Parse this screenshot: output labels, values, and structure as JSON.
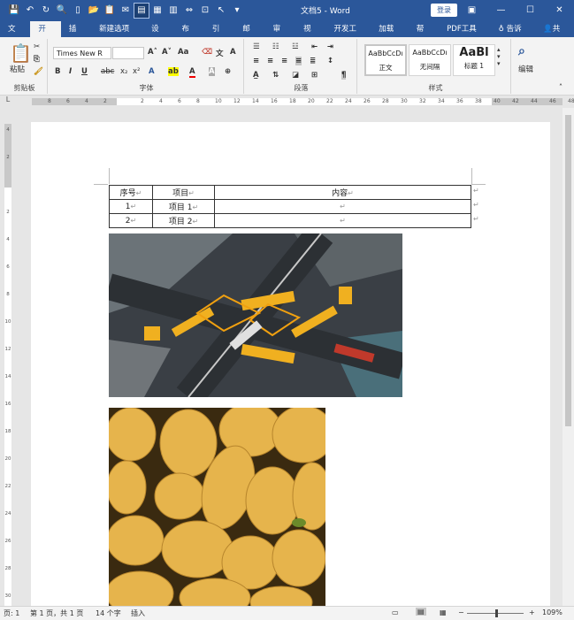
{
  "titlebar": {
    "doc_title": "文档5 - Word",
    "login_label": "登录"
  },
  "menu_tabs": [
    {
      "label": "文件"
    },
    {
      "label": "开始"
    },
    {
      "label": "插入"
    },
    {
      "label": "新建选项卡"
    },
    {
      "label": "设计"
    },
    {
      "label": "布局"
    },
    {
      "label": "引用"
    },
    {
      "label": "邮件"
    },
    {
      "label": "审阅"
    },
    {
      "label": "视图"
    },
    {
      "label": "开发工具"
    },
    {
      "label": "加载项"
    },
    {
      "label": "帮助"
    },
    {
      "label": "PDF工具集"
    }
  ],
  "tell_me": "告诉我",
  "share": "共享",
  "ribbon": {
    "clipboard": {
      "label": "剪贴板",
      "paste": "粘贴"
    },
    "font": {
      "label": "字体",
      "font_name": "Times New R",
      "font_size": ""
    },
    "paragraph": {
      "label": "段落"
    },
    "styles": {
      "label": "样式",
      "items": [
        {
          "preview": "AaBbCcDı",
          "name": "正文"
        },
        {
          "preview": "AaBbCcDı",
          "name": "无间隔"
        },
        {
          "preview": "AaBl",
          "name": "标题 1"
        }
      ]
    },
    "editing": {
      "label": "编辑"
    }
  },
  "ruler": {
    "ticks": [
      "8",
      "6",
      "4",
      "2",
      "",
      "2",
      "4",
      "6",
      "8",
      "10",
      "12",
      "14",
      "16",
      "18",
      "20",
      "22",
      "24",
      "26",
      "28",
      "30",
      "32",
      "34",
      "36",
      "38",
      "40",
      "42",
      "44",
      "46",
      "48"
    ]
  },
  "vruler": {
    "ticks": [
      "4",
      "2",
      "",
      "2",
      "4",
      "6",
      "8",
      "10",
      "12",
      "14",
      "16",
      "18",
      "20",
      "22",
      "24",
      "26",
      "28",
      "30"
    ]
  },
  "table": {
    "headers": [
      "序号",
      "项目",
      "内容"
    ],
    "rows": [
      [
        "1",
        "项目 1",
        ""
      ],
      [
        "2",
        "项目 2",
        ""
      ]
    ]
  },
  "status": {
    "page": "页: 1",
    "pages": "第 1 页，共 1 页",
    "words": "14 个字",
    "mode": "插入",
    "zoom": "109%"
  }
}
